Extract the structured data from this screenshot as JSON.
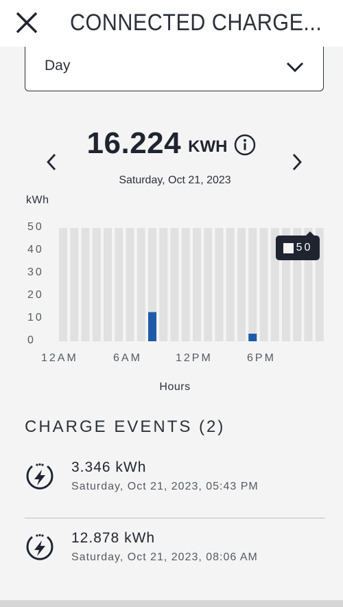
{
  "header": {
    "title": "CONNECTED CHARGE...",
    "close_icon": "close-icon"
  },
  "period_select": {
    "value": "Day"
  },
  "summary": {
    "total": "16.224",
    "unit": "KWH",
    "date": "Saturday, Oct 21, 2023"
  },
  "chart_data": {
    "type": "bar",
    "ylabel": "kWh",
    "xlabel": "Hours",
    "ylim": [
      0,
      50
    ],
    "yticks": [
      "50",
      "40",
      "30",
      "20",
      "10",
      "0"
    ],
    "xticks": [
      "12AM",
      "6AM",
      "12PM",
      "6PM"
    ],
    "categories": [
      "0",
      "1",
      "2",
      "3",
      "4",
      "5",
      "6",
      "7",
      "8",
      "9",
      "10",
      "11",
      "12",
      "13",
      "14",
      "15",
      "16",
      "17",
      "18",
      "19",
      "20",
      "21",
      "22",
      "23"
    ],
    "values": [
      0,
      0,
      0,
      0,
      0,
      0,
      0,
      0,
      12.878,
      0,
      0,
      0,
      0,
      0,
      0,
      0,
      0,
      3.346,
      0,
      0,
      0,
      0,
      0,
      0
    ],
    "background_value": 50,
    "bar_color": "#1e5aa8",
    "background_bar_color": "#e1e1e1",
    "tooltip": {
      "value": "50"
    }
  },
  "events": {
    "title": "CHARGE EVENTS (2)",
    "items": [
      {
        "kwh": "3.346 kWh",
        "date": "Saturday, Oct 21, 2023, 05:43 PM"
      },
      {
        "kwh": "12.878 kWh",
        "date": "Saturday, Oct 21, 2023, 08:06 AM"
      }
    ]
  }
}
